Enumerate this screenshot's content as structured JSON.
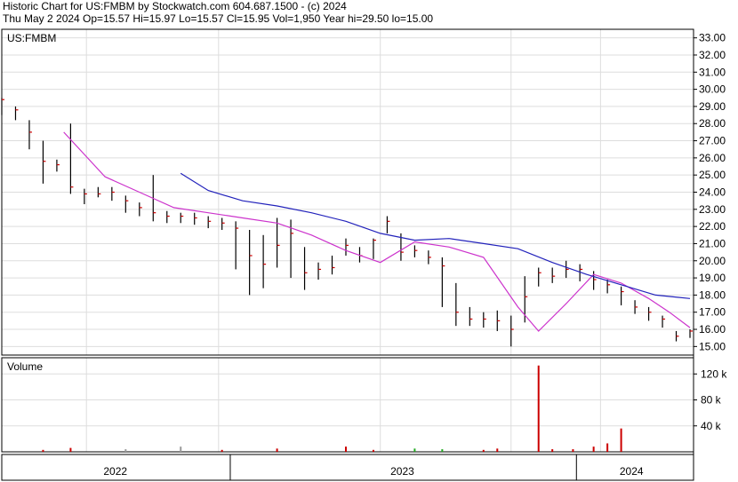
{
  "header": {
    "line1": "Historic Chart for US:FMBM by Stockwatch.com 604.687.1500 - (c) 2024",
    "line2": "Thu May  2 2024   Op=15.57   Hi=15.97   Lo=15.57   Cl=15.95   Vol=1,950   Year hi=29.50   lo=15.00"
  },
  "colors": {
    "price_bar": "#000000",
    "price_close_tick": "#cc0000",
    "ma_short": "#cc33cc",
    "ma_long": "#2222bb",
    "volume_up": "#22aa22",
    "volume_down": "#cc0000",
    "volume_neutral": "#999999",
    "grid": "#dddddd"
  },
  "chart_data": [
    {
      "type": "line",
      "panel": "price",
      "title": "US:FMBM",
      "ylim": [
        14.5,
        33.5
      ],
      "y_ticks": [
        "33.00",
        "32.00",
        "31.00",
        "30.00",
        "29.00",
        "28.00",
        "27.00",
        "26.00",
        "25.00",
        "24.00",
        "23.00",
        "22.00",
        "21.00",
        "20.00",
        "19.00",
        "18.00",
        "17.00",
        "16.00",
        "15.00"
      ],
      "x_labels": [
        "2022",
        "2023",
        "2024"
      ],
      "grid": true,
      "series": [
        {
          "style": "ohlc_bars",
          "x": [
            0,
            0.02,
            0.04,
            0.06,
            0.08,
            0.1,
            0.12,
            0.14,
            0.16,
            0.18,
            0.2,
            0.22,
            0.24,
            0.26,
            0.28,
            0.3,
            0.32,
            0.34,
            0.36,
            0.38,
            0.4,
            0.42,
            0.44,
            0.46,
            0.48,
            0.5,
            0.52,
            0.54,
            0.56,
            0.58,
            0.6,
            0.62,
            0.64,
            0.66,
            0.68,
            0.7,
            0.72,
            0.74,
            0.76,
            0.78,
            0.8,
            0.82,
            0.84,
            0.86,
            0.88,
            0.9,
            0.92,
            0.94,
            0.96,
            0.98,
            1.0
          ],
          "values": [
            29.4,
            28.8,
            27.5,
            25.8,
            25.6,
            24.3,
            23.9,
            23.9,
            24.0,
            23.5,
            23.1,
            22.8,
            22.6,
            22.6,
            22.5,
            22.3,
            22.2,
            21.9,
            20.3,
            19.8,
            20.9,
            21.6,
            19.3,
            19.5,
            19.6,
            20.9,
            20.3,
            21.2,
            22.3,
            20.5,
            20.6,
            20.2,
            19.7,
            17.0,
            16.6,
            16.6,
            16.5,
            16.0,
            17.9,
            19.3,
            19.1,
            19.5,
            19.5,
            18.9,
            18.6,
            18.2,
            17.3,
            17.0,
            16.6,
            15.6,
            15.9
          ],
          "highs": [
            29.5,
            29.0,
            28.2,
            27.0,
            25.9,
            28.0,
            24.2,
            24.3,
            24.3,
            23.8,
            23.4,
            25.0,
            22.9,
            22.8,
            22.8,
            22.6,
            22.5,
            22.3,
            21.8,
            21.5,
            22.5,
            22.4,
            20.8,
            19.9,
            20.3,
            21.3,
            20.8,
            21.3,
            22.6,
            21.6,
            20.9,
            20.6,
            20.2,
            18.7,
            17.3,
            17.0,
            17.1,
            16.8,
            19.1,
            19.6,
            19.6,
            20.0,
            19.8,
            19.4,
            18.9,
            18.5,
            17.7,
            17.3,
            16.8,
            15.9,
            16.0
          ],
          "lows": [
            28.5,
            28.2,
            26.5,
            24.5,
            25.2,
            23.9,
            23.3,
            23.7,
            23.5,
            22.8,
            22.6,
            22.3,
            22.2,
            22.2,
            22.1,
            21.9,
            21.8,
            19.5,
            18.0,
            18.4,
            19.6,
            19.0,
            18.3,
            18.9,
            19.2,
            20.3,
            19.9,
            20.1,
            21.6,
            20.0,
            20.2,
            19.8,
            17.3,
            16.2,
            16.2,
            16.1,
            15.9,
            15.0,
            16.4,
            18.5,
            18.7,
            19.0,
            18.8,
            18.3,
            18.1,
            17.4,
            16.9,
            16.5,
            16.1,
            15.3,
            15.5
          ]
        },
        {
          "style": "moving_average_short",
          "x": [
            0.09,
            0.15,
            0.2,
            0.25,
            0.3,
            0.35,
            0.4,
            0.45,
            0.5,
            0.55,
            0.6,
            0.65,
            0.7,
            0.75,
            0.78,
            0.82,
            0.86,
            0.9,
            0.94,
            0.97,
            1.0
          ],
          "values": [
            27.5,
            24.9,
            24.0,
            23.1,
            22.8,
            22.5,
            22.2,
            21.5,
            20.6,
            19.9,
            21.1,
            20.8,
            20.2,
            17.3,
            15.9,
            17.5,
            19.2,
            18.7,
            17.8,
            17.0,
            16.1
          ]
        },
        {
          "style": "moving_average_long",
          "x": [
            0.26,
            0.3,
            0.35,
            0.4,
            0.45,
            0.5,
            0.55,
            0.6,
            0.65,
            0.7,
            0.75,
            0.8,
            0.85,
            0.9,
            0.95,
            1.0
          ],
          "values": [
            25.1,
            24.1,
            23.5,
            23.2,
            22.8,
            22.3,
            21.6,
            21.2,
            21.3,
            21.0,
            20.7,
            19.9,
            19.2,
            18.6,
            18.0,
            17.8
          ]
        }
      ]
    },
    {
      "type": "bar",
      "panel": "volume",
      "title": "Volume",
      "ylim": [
        0,
        145
      ],
      "y_ticks": [
        "120 k",
        "80 k",
        "40 k"
      ],
      "x": [
        0.06,
        0.1,
        0.18,
        0.26,
        0.32,
        0.4,
        0.5,
        0.54,
        0.6,
        0.64,
        0.7,
        0.72,
        0.78,
        0.8,
        0.83,
        0.86,
        0.88,
        0.9
      ],
      "values": [
        3,
        6,
        4,
        8,
        3,
        5,
        8,
        3,
        5,
        4,
        3,
        5,
        133,
        4,
        4,
        8,
        13,
        36
      ],
      "colors": [
        "down",
        "down",
        "neutral",
        "neutral",
        "down",
        "down",
        "down",
        "down",
        "up",
        "up",
        "down",
        "down",
        "down",
        "down",
        "down",
        "down",
        "down",
        "down"
      ]
    }
  ]
}
